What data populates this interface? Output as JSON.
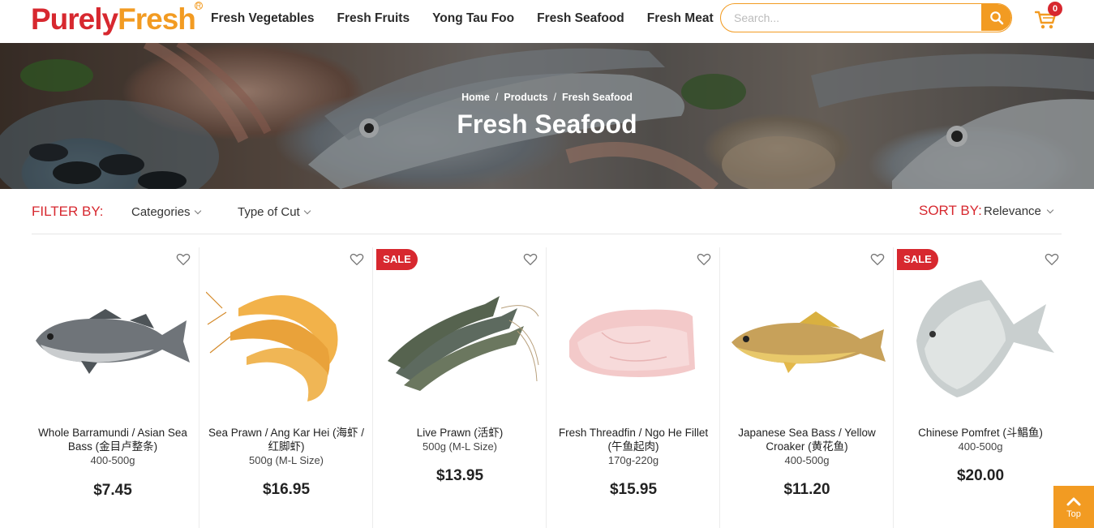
{
  "brand": {
    "name_part1": "Purely",
    "name_part2": "Fresh",
    "reg_mark": "R"
  },
  "nav": {
    "items": [
      {
        "label": "Fresh Vegetables"
      },
      {
        "label": "Fresh Fruits"
      },
      {
        "label": "Yong Tau Foo"
      },
      {
        "label": "Fresh Seafood"
      },
      {
        "label": "Fresh Meat"
      }
    ]
  },
  "search": {
    "placeholder": "Search...",
    "value": ""
  },
  "cart": {
    "count": "0"
  },
  "banner": {
    "breadcrumb": [
      "Home",
      "Products",
      "Fresh Seafood"
    ],
    "breadcrumb_sep": "/",
    "title": "Fresh Seafood"
  },
  "filter": {
    "label": "FILTER BY:",
    "categories": "Categories",
    "type_of_cut": "Type of Cut"
  },
  "sort": {
    "label": "SORT BY:",
    "value": "Relevance"
  },
  "products": [
    {
      "name": "Whole Barramundi / Asian Sea Bass (金目卢整条)",
      "weight": "400-500g",
      "price": "$7.45",
      "sale": false,
      "sale_label": "",
      "image": "barramundi-fish"
    },
    {
      "name": "Sea Prawn / Ang Kar Hei (海虾 / 红脚虾)",
      "weight": "500g (M-L Size)",
      "price": "$16.95",
      "sale": false,
      "sale_label": "",
      "image": "sea-prawns"
    },
    {
      "name": "Live Prawn (活虾)",
      "weight": "500g (M-L Size)",
      "price": "$13.95",
      "sale": true,
      "sale_label": "SALE",
      "image": "live-prawns"
    },
    {
      "name": "Fresh Threadfin / Ngo He Fillet (午鱼起肉)",
      "weight": "170g-220g",
      "price": "$15.95",
      "sale": false,
      "sale_label": "",
      "image": "threadfin-fillet"
    },
    {
      "name": "Japanese Sea Bass / Yellow Croaker (黄花鱼)",
      "weight": "400-500g",
      "price": "$11.20",
      "sale": false,
      "sale_label": "",
      "image": "yellow-croaker"
    },
    {
      "name": "Chinese Pomfret (斗鲳鱼)",
      "weight": "400-500g",
      "price": "$20.00",
      "sale": true,
      "sale_label": "SALE",
      "image": "pomfret-fish"
    }
  ],
  "top_button": {
    "label": "Top"
  },
  "colors": {
    "brand_red": "#d7282f",
    "brand_orange": "#f29b22"
  }
}
